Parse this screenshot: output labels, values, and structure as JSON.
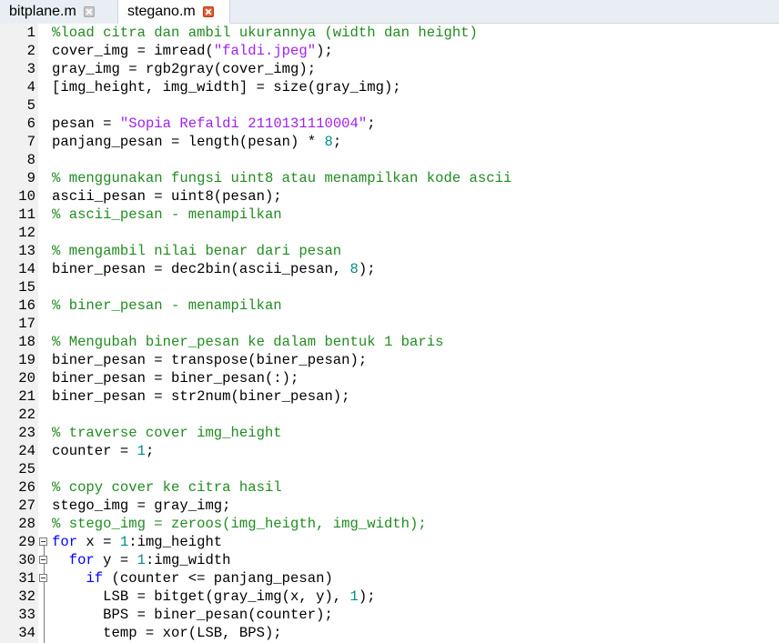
{
  "tabs": [
    {
      "label": "bitplane.m",
      "active": false,
      "close_icon": "close-grey-icon"
    },
    {
      "label": "stegano.m",
      "active": true,
      "close_icon": "close-red-icon"
    }
  ],
  "colors": {
    "comment": "#228b22",
    "string": "#a020f0",
    "number": "#008b8b",
    "keyword": "#0000ff",
    "text": "#000000"
  },
  "lines": [
    {
      "n": "1",
      "tokens": [
        {
          "t": "cm",
          "s": "%load citra dan ambil ukurannya (width dan height)"
        }
      ]
    },
    {
      "n": "2",
      "tokens": [
        {
          "t": "",
          "s": "cover_img = imread("
        },
        {
          "t": "str",
          "s": "\"faldi.jpeg\""
        },
        {
          "t": "",
          "s": ");"
        }
      ]
    },
    {
      "n": "3",
      "tokens": [
        {
          "t": "",
          "s": "gray_img = rgb2gray(cover_img);"
        }
      ]
    },
    {
      "n": "4",
      "tokens": [
        {
          "t": "",
          "s": "[img_height, img_width] = size(gray_img);"
        }
      ]
    },
    {
      "n": "5",
      "tokens": []
    },
    {
      "n": "6",
      "tokens": [
        {
          "t": "",
          "s": "pesan = "
        },
        {
          "t": "str",
          "s": "\"Sopia Refaldi 2110131110004\""
        },
        {
          "t": "",
          "s": ";"
        }
      ]
    },
    {
      "n": "7",
      "tokens": [
        {
          "t": "",
          "s": "panjang_pesan = length(pesan) * "
        },
        {
          "t": "num",
          "s": "8"
        },
        {
          "t": "",
          "s": ";"
        }
      ]
    },
    {
      "n": "8",
      "tokens": []
    },
    {
      "n": "9",
      "tokens": [
        {
          "t": "cm",
          "s": "% menggunakan fungsi uint8 atau menampilkan kode ascii"
        }
      ]
    },
    {
      "n": "10",
      "tokens": [
        {
          "t": "",
          "s": "ascii_pesan = uint8(pesan);"
        }
      ]
    },
    {
      "n": "11",
      "tokens": [
        {
          "t": "cm",
          "s": "% ascii_pesan - menampilkan"
        }
      ]
    },
    {
      "n": "12",
      "tokens": []
    },
    {
      "n": "13",
      "tokens": [
        {
          "t": "cm",
          "s": "% mengambil nilai benar dari pesan"
        }
      ]
    },
    {
      "n": "14",
      "tokens": [
        {
          "t": "",
          "s": "biner_pesan = dec2bin(ascii_pesan, "
        },
        {
          "t": "num",
          "s": "8"
        },
        {
          "t": "",
          "s": ");"
        }
      ]
    },
    {
      "n": "15",
      "tokens": []
    },
    {
      "n": "16",
      "tokens": [
        {
          "t": "cm",
          "s": "% biner_pesan - menampilkan"
        }
      ]
    },
    {
      "n": "17",
      "tokens": []
    },
    {
      "n": "18",
      "tokens": [
        {
          "t": "cm",
          "s": "% Mengubah biner_pesan ke dalam bentuk 1 baris"
        }
      ]
    },
    {
      "n": "19",
      "tokens": [
        {
          "t": "",
          "s": "biner_pesan = transpose(biner_pesan);"
        }
      ]
    },
    {
      "n": "20",
      "tokens": [
        {
          "t": "",
          "s": "biner_pesan = biner_pesan(:);"
        }
      ]
    },
    {
      "n": "21",
      "tokens": [
        {
          "t": "",
          "s": "biner_pesan = str2num(biner_pesan);"
        }
      ]
    },
    {
      "n": "22",
      "tokens": []
    },
    {
      "n": "23",
      "tokens": [
        {
          "t": "cm",
          "s": "% traverse cover img_height"
        }
      ]
    },
    {
      "n": "24",
      "tokens": [
        {
          "t": "",
          "s": "counter = "
        },
        {
          "t": "num",
          "s": "1"
        },
        {
          "t": "",
          "s": ";"
        }
      ]
    },
    {
      "n": "25",
      "tokens": []
    },
    {
      "n": "26",
      "tokens": [
        {
          "t": "cm",
          "s": "% copy cover ke citra hasil"
        }
      ]
    },
    {
      "n": "27",
      "tokens": [
        {
          "t": "",
          "s": "stego_img = gray_img;"
        }
      ]
    },
    {
      "n": "28",
      "tokens": [
        {
          "t": "cm",
          "s": "% stego_img = zeroos(img_heigth, img_width);"
        }
      ]
    },
    {
      "n": "29",
      "fold": true,
      "tokens": [
        {
          "t": "kw",
          "s": "for"
        },
        {
          "t": "",
          "s": " x = "
        },
        {
          "t": "num",
          "s": "1"
        },
        {
          "t": "",
          "s": ":img_height"
        }
      ]
    },
    {
      "n": "30",
      "fold": true,
      "tokens": [
        {
          "t": "",
          "s": "  "
        },
        {
          "t": "kw",
          "s": "for"
        },
        {
          "t": "",
          "s": " y = "
        },
        {
          "t": "num",
          "s": "1"
        },
        {
          "t": "",
          "s": ":img_width"
        }
      ]
    },
    {
      "n": "31",
      "fold": true,
      "tokens": [
        {
          "t": "",
          "s": "    "
        },
        {
          "t": "kw",
          "s": "if"
        },
        {
          "t": "",
          "s": " (counter <= panjang_pesan)"
        }
      ]
    },
    {
      "n": "32",
      "tokens": [
        {
          "t": "",
          "s": "      LSB = bitget(gray_img(x, y), "
        },
        {
          "t": "num",
          "s": "1"
        },
        {
          "t": "",
          "s": ");"
        }
      ]
    },
    {
      "n": "33",
      "tokens": [
        {
          "t": "",
          "s": "      BPS = biner_pesan(counter);"
        }
      ]
    },
    {
      "n": "34",
      "tokens": [
        {
          "t": "",
          "s": "      temp = xor(LSB, BPS);"
        }
      ]
    }
  ]
}
